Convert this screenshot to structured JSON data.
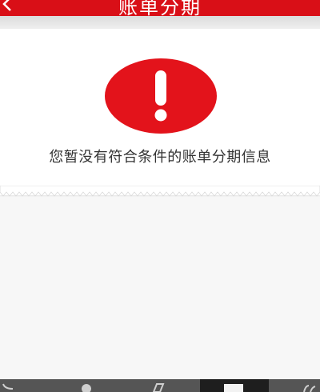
{
  "header": {
    "title": "账单分期",
    "back_icon": "chevron-left-icon",
    "color": "#d90f17"
  },
  "empty_state": {
    "icon": "exclamation-circle-icon",
    "icon_color": "#e3131b",
    "message": "您暂没有符合条件的账单分期信息"
  },
  "bottom_nav": {
    "items": [
      "back-icon",
      "home-icon",
      "recents-icon",
      "menu-icon",
      "volume-icon"
    ],
    "active_item": "menu-icon"
  }
}
